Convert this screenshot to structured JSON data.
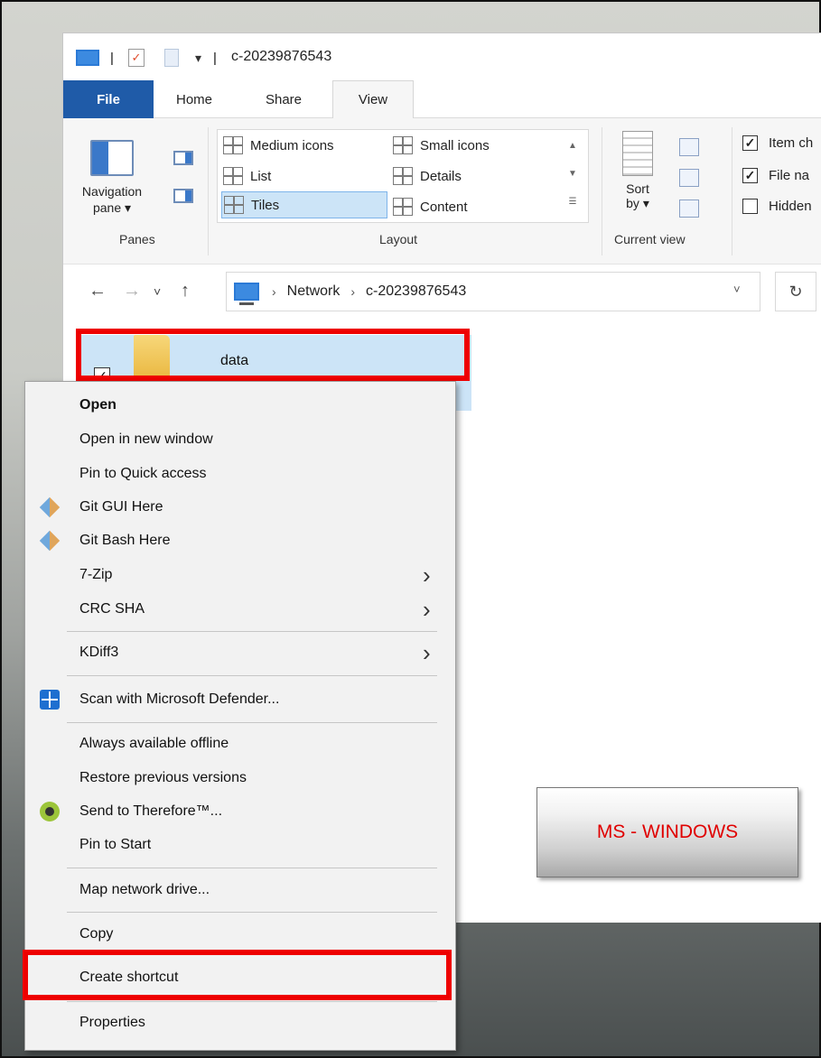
{
  "window": {
    "title": "c-20239876543",
    "quick_access_separator": "|",
    "quick_access_dropdown": "▾"
  },
  "tabs": [
    "File",
    "Home",
    "Share",
    "View"
  ],
  "ribbon": {
    "panes": {
      "navigation_pane_line1": "Navigation",
      "navigation_pane_line2": "pane ▾",
      "group_label": "Panes"
    },
    "layout": {
      "items": [
        "Medium icons",
        "Small icons",
        "List",
        "Details",
        "Tiles",
        "Content"
      ],
      "selected": "Tiles",
      "group_label": "Layout"
    },
    "current_view": {
      "sort_line1": "Sort",
      "sort_line2": "by ▾",
      "group_label": "Current view"
    },
    "show_hide": {
      "items": [
        {
          "label": "Item ch",
          "checked": true
        },
        {
          "label": "File na",
          "checked": true
        },
        {
          "label": "Hidden",
          "checked": false
        }
      ]
    }
  },
  "address_bar": {
    "back": "←",
    "forward": "→",
    "recent": "˅",
    "up": "↑",
    "crumbs": [
      "Network",
      "c-20239876543"
    ],
    "crumb_separator": "›",
    "dropdown": "˅",
    "refresh": "↻"
  },
  "files": [
    {
      "name": "data",
      "type": "folder",
      "selected": true,
      "checkmark": "✓"
    }
  ],
  "context_menu": {
    "items": [
      {
        "label": "Open",
        "bold": true
      },
      {
        "label": "Open in new window"
      },
      {
        "label": "Pin to Quick access"
      },
      {
        "label": "Git GUI Here",
        "icon": "git-gui-icon"
      },
      {
        "label": "Git Bash Here",
        "icon": "git-bash-icon"
      },
      {
        "label": "7-Zip",
        "submenu": true
      },
      {
        "label": "CRC SHA",
        "submenu": true
      },
      {
        "label": "KDiff3",
        "submenu": true
      },
      {
        "label": "Scan with Microsoft Defender...",
        "icon": "defender-icon"
      },
      {
        "label": "Always available offline"
      },
      {
        "label": "Restore previous versions"
      },
      {
        "label": "Send to Therefore™...",
        "icon": "therefore-icon"
      },
      {
        "label": "Pin to Start"
      },
      {
        "label": "Map network drive..."
      },
      {
        "label": "Copy"
      },
      {
        "label": "Create shortcut",
        "highlighted": true
      },
      {
        "label": "Properties"
      }
    ],
    "submenu_arrow": "›"
  },
  "badge": {
    "text": "MS - WINDOWS",
    "color": "#e00000"
  },
  "highlight_color": "#ee0000"
}
